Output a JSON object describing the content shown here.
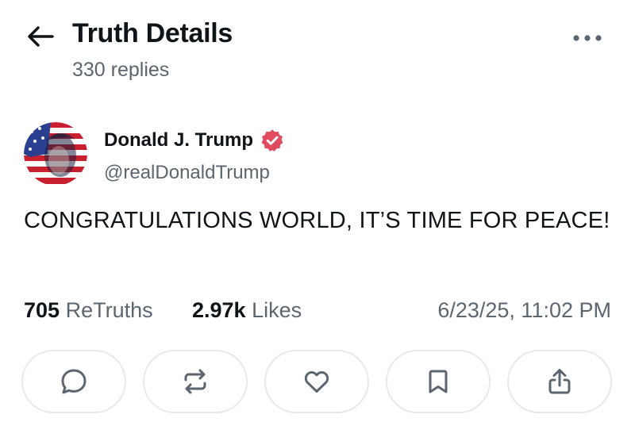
{
  "header": {
    "title": "Truth Details",
    "subtitle": "330 replies",
    "back_icon": "arrow-left-icon",
    "more_icon": "ellipsis-horizontal-icon"
  },
  "author": {
    "name": "Donald J. Trump",
    "handle": "@realDonaldTrump",
    "verified": true,
    "verified_color": "#e04b5f",
    "avatar_icon": "avatar-image"
  },
  "post": {
    "text": "CONGRATULATIONS WORLD, IT’S TIME FOR PEACE!"
  },
  "stats": {
    "retruths_count": "705",
    "retruths_label": "ReTruths",
    "likes_count": "2.97k",
    "likes_label": "Likes",
    "timestamp": "6/23/25, 11:02 PM"
  },
  "actions": [
    {
      "name": "reply",
      "icon": "comment-icon"
    },
    {
      "name": "retruth",
      "icon": "repost-icon"
    },
    {
      "name": "like",
      "icon": "heart-icon"
    },
    {
      "name": "bookmark",
      "icon": "bookmark-icon"
    },
    {
      "name": "share",
      "icon": "share-icon"
    }
  ],
  "colors": {
    "text_primary": "#0f1419",
    "text_secondary": "#5c6670",
    "icon_muted": "#5c6670",
    "border": "#e6e9ec"
  }
}
